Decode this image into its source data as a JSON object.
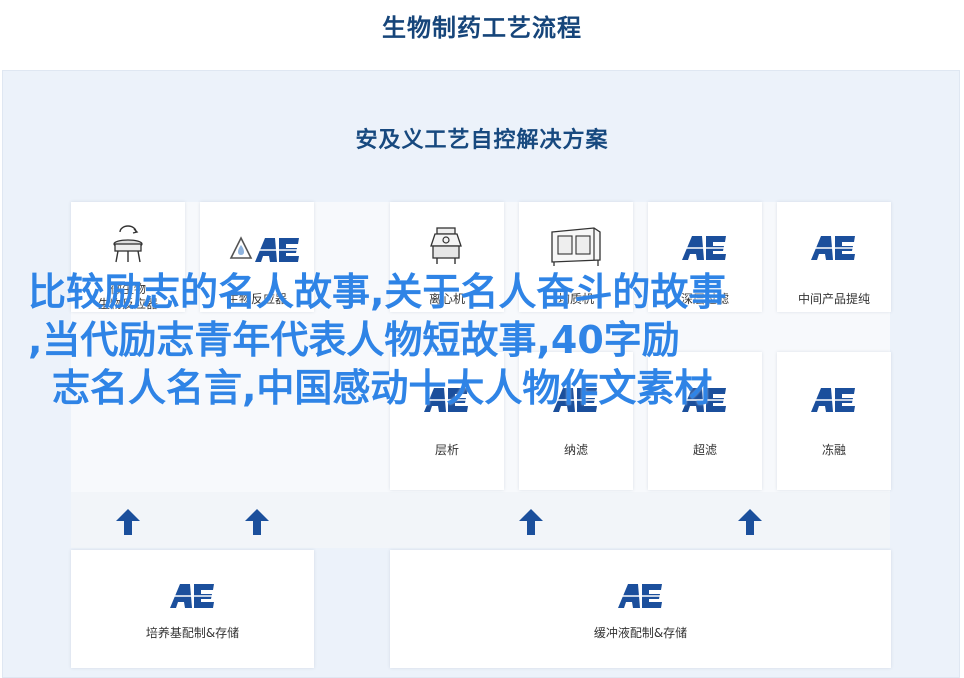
{
  "page": {
    "title": "生物制药工艺流程",
    "subtitle": "安及义工艺自控解决方案"
  },
  "colors": {
    "title": "#16457a",
    "accent": "#1b4f9c",
    "panel": "#ecf2fa",
    "overlay_text": "#2f84e6"
  },
  "cards_top": [
    {
      "label_1": "微生物",
      "label_2": "生物反应器",
      "icon": "bioreactor-icon"
    },
    {
      "label_1": "生物反应器",
      "label_2": "",
      "icon": "ae-logo"
    },
    {
      "label_1": "离心机",
      "label_2": "",
      "icon": "centrifuge-icon"
    },
    {
      "label_1": "均质机",
      "label_2": "",
      "icon": "homogenizer-icon"
    },
    {
      "label_1": "深层过滤",
      "label_2": "",
      "icon": "ae-logo"
    },
    {
      "label_1": "中间产品提纯",
      "label_2": "",
      "icon": "ae-logo"
    }
  ],
  "cards_mid": [
    {
      "label": "层析"
    },
    {
      "label": "纳滤"
    },
    {
      "label": "超滤"
    },
    {
      "label": "冻融"
    }
  ],
  "cards_bottom": [
    {
      "label": "培养基配制&存储"
    },
    {
      "label": "缓冲液配制&存储"
    }
  ],
  "brand": {
    "logo_text": "AE"
  },
  "overlay": {
    "line1": "比较励志的名人故事,关于名人奋斗的故事",
    "line2": ",当代励志青年代表人物短故事,40字励",
    "line3": "志名人名言,中国感动十大人物作文素材"
  }
}
